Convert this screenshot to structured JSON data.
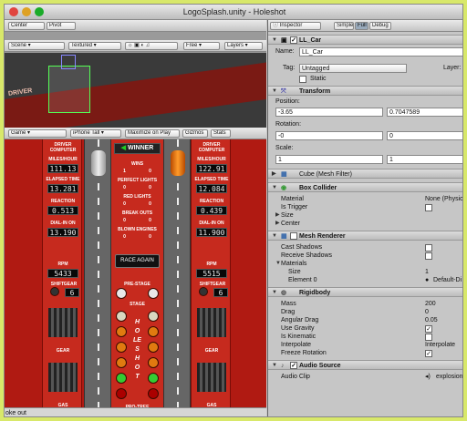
{
  "window": {
    "title": "LogoSplash.unity - Holeshot"
  },
  "scene_toolbar": {
    "center": "Center",
    "pivot": "Pivot",
    "scene": "Scene",
    "textured": "Textured",
    "free": "Free",
    "layers": "Layers"
  },
  "game_toolbar": {
    "game": "Game",
    "resolution": "iPhone Tall",
    "maximize": "Maximize on Play",
    "gizmos": "Gizmos",
    "stats": "Stats"
  },
  "scene_view": {
    "label": "DRIVER"
  },
  "game": {
    "left": {
      "driver": "DRIVER",
      "computer": "COMPUTER",
      "mph_label": "MILES/HOUR",
      "mph": "111.13",
      "et_label": "ELAPSED TIME",
      "et": "13.281",
      "reaction_label": "REACTION",
      "reaction": "0.513",
      "dial_label": "DIAL-IN ON",
      "dial": "13.190",
      "rpm_label": "RPM",
      "rpm": "5433",
      "shift_label": "SHIFT",
      "gear_label": "GEAR",
      "gear": "6",
      "gear_title": "GEAR",
      "gas": "GAS"
    },
    "right": {
      "driver": "DRIVER",
      "computer": "COMPUTER",
      "mph_label": "MILES/HOUR",
      "mph": "122.91",
      "et_label": "ELAPSED TIME",
      "et": "12.084",
      "reaction_label": "REACTION",
      "reaction": "0.439",
      "dial_label": "DIAL-IN ON",
      "dial": "11.900",
      "rpm_label": "RPM",
      "rpm": "5515",
      "shift_label": "SHIFT",
      "gear_label": "GEAR",
      "gear": "6",
      "gear_title": "GEAR",
      "gas": "GAS"
    },
    "center": {
      "winner": "WINNER",
      "wins": "WINS",
      "wins_l": "1",
      "wins_r": "0",
      "perfect": "PERFECT LIGHTS",
      "perfect_l": "0",
      "perfect_r": "0",
      "red": "RED LIGHTS",
      "red_l": "0",
      "red_r": "0",
      "breakouts": "BREAK OUTS",
      "breakouts_l": "0",
      "breakouts_r": "0",
      "blown": "BLOWN ENGINES",
      "blown_l": "0",
      "blown_r": "0",
      "race_again": "RACE AGAIN",
      "prestage": "PRE-STAGE",
      "stage": "STAGE",
      "holeshot": "HOLESHOT",
      "protree": "PRO-TREE"
    }
  },
  "status": {
    "text": "oke out"
  },
  "inspector": {
    "tab": "Inspector",
    "simple": "Simple",
    "full": "Full",
    "debug": "Debug",
    "object_name": "LL_Car",
    "name_label": "Name:",
    "name_value": "LL_Car",
    "tag_label": "Tag:",
    "tag_value": "Untagged",
    "layer_label": "Layer:",
    "static_label": "Static",
    "transform": {
      "title": "Transform",
      "position_label": "Position:",
      "pos_x": "-3.65",
      "pos_y": "0.7047589",
      "rotation_label": "Rotation:",
      "rot_x": "-0",
      "rot_y": "0",
      "scale_label": "Scale:",
      "scale_x": "1",
      "scale_y": "1"
    },
    "cube": {
      "title": "Cube (Mesh Filter)"
    },
    "box_collider": {
      "title": "Box Collider",
      "material_label": "Material",
      "material_value": "None (Physic M",
      "trigger_label": "Is Trigger",
      "size_label": "Size",
      "center_label": "Center"
    },
    "mesh_renderer": {
      "title": "Mesh Renderer",
      "cast_label": "Cast Shadows",
      "receive_label": "Receive Shadows",
      "materials_label": "Materials",
      "size_label": "Size",
      "size_value": "1",
      "element_label": "Element 0",
      "element_value": "Default-Di"
    },
    "rigidbody": {
      "title": "Rigidbody",
      "mass_label": "Mass",
      "mass": "200",
      "drag_label": "Drag",
      "drag": "0",
      "angular_label": "Angular Drag",
      "angular": "0.05",
      "gravity_label": "Use Gravity",
      "kinematic_label": "Is Kinematic",
      "interp_label": "Interpolate",
      "interp": "Interpolate",
      "freeze_label": "Freeze Rotation"
    },
    "audio": {
      "title": "Audio Source",
      "clip_label": "Audio Clip",
      "clip_value": "explosion"
    }
  }
}
